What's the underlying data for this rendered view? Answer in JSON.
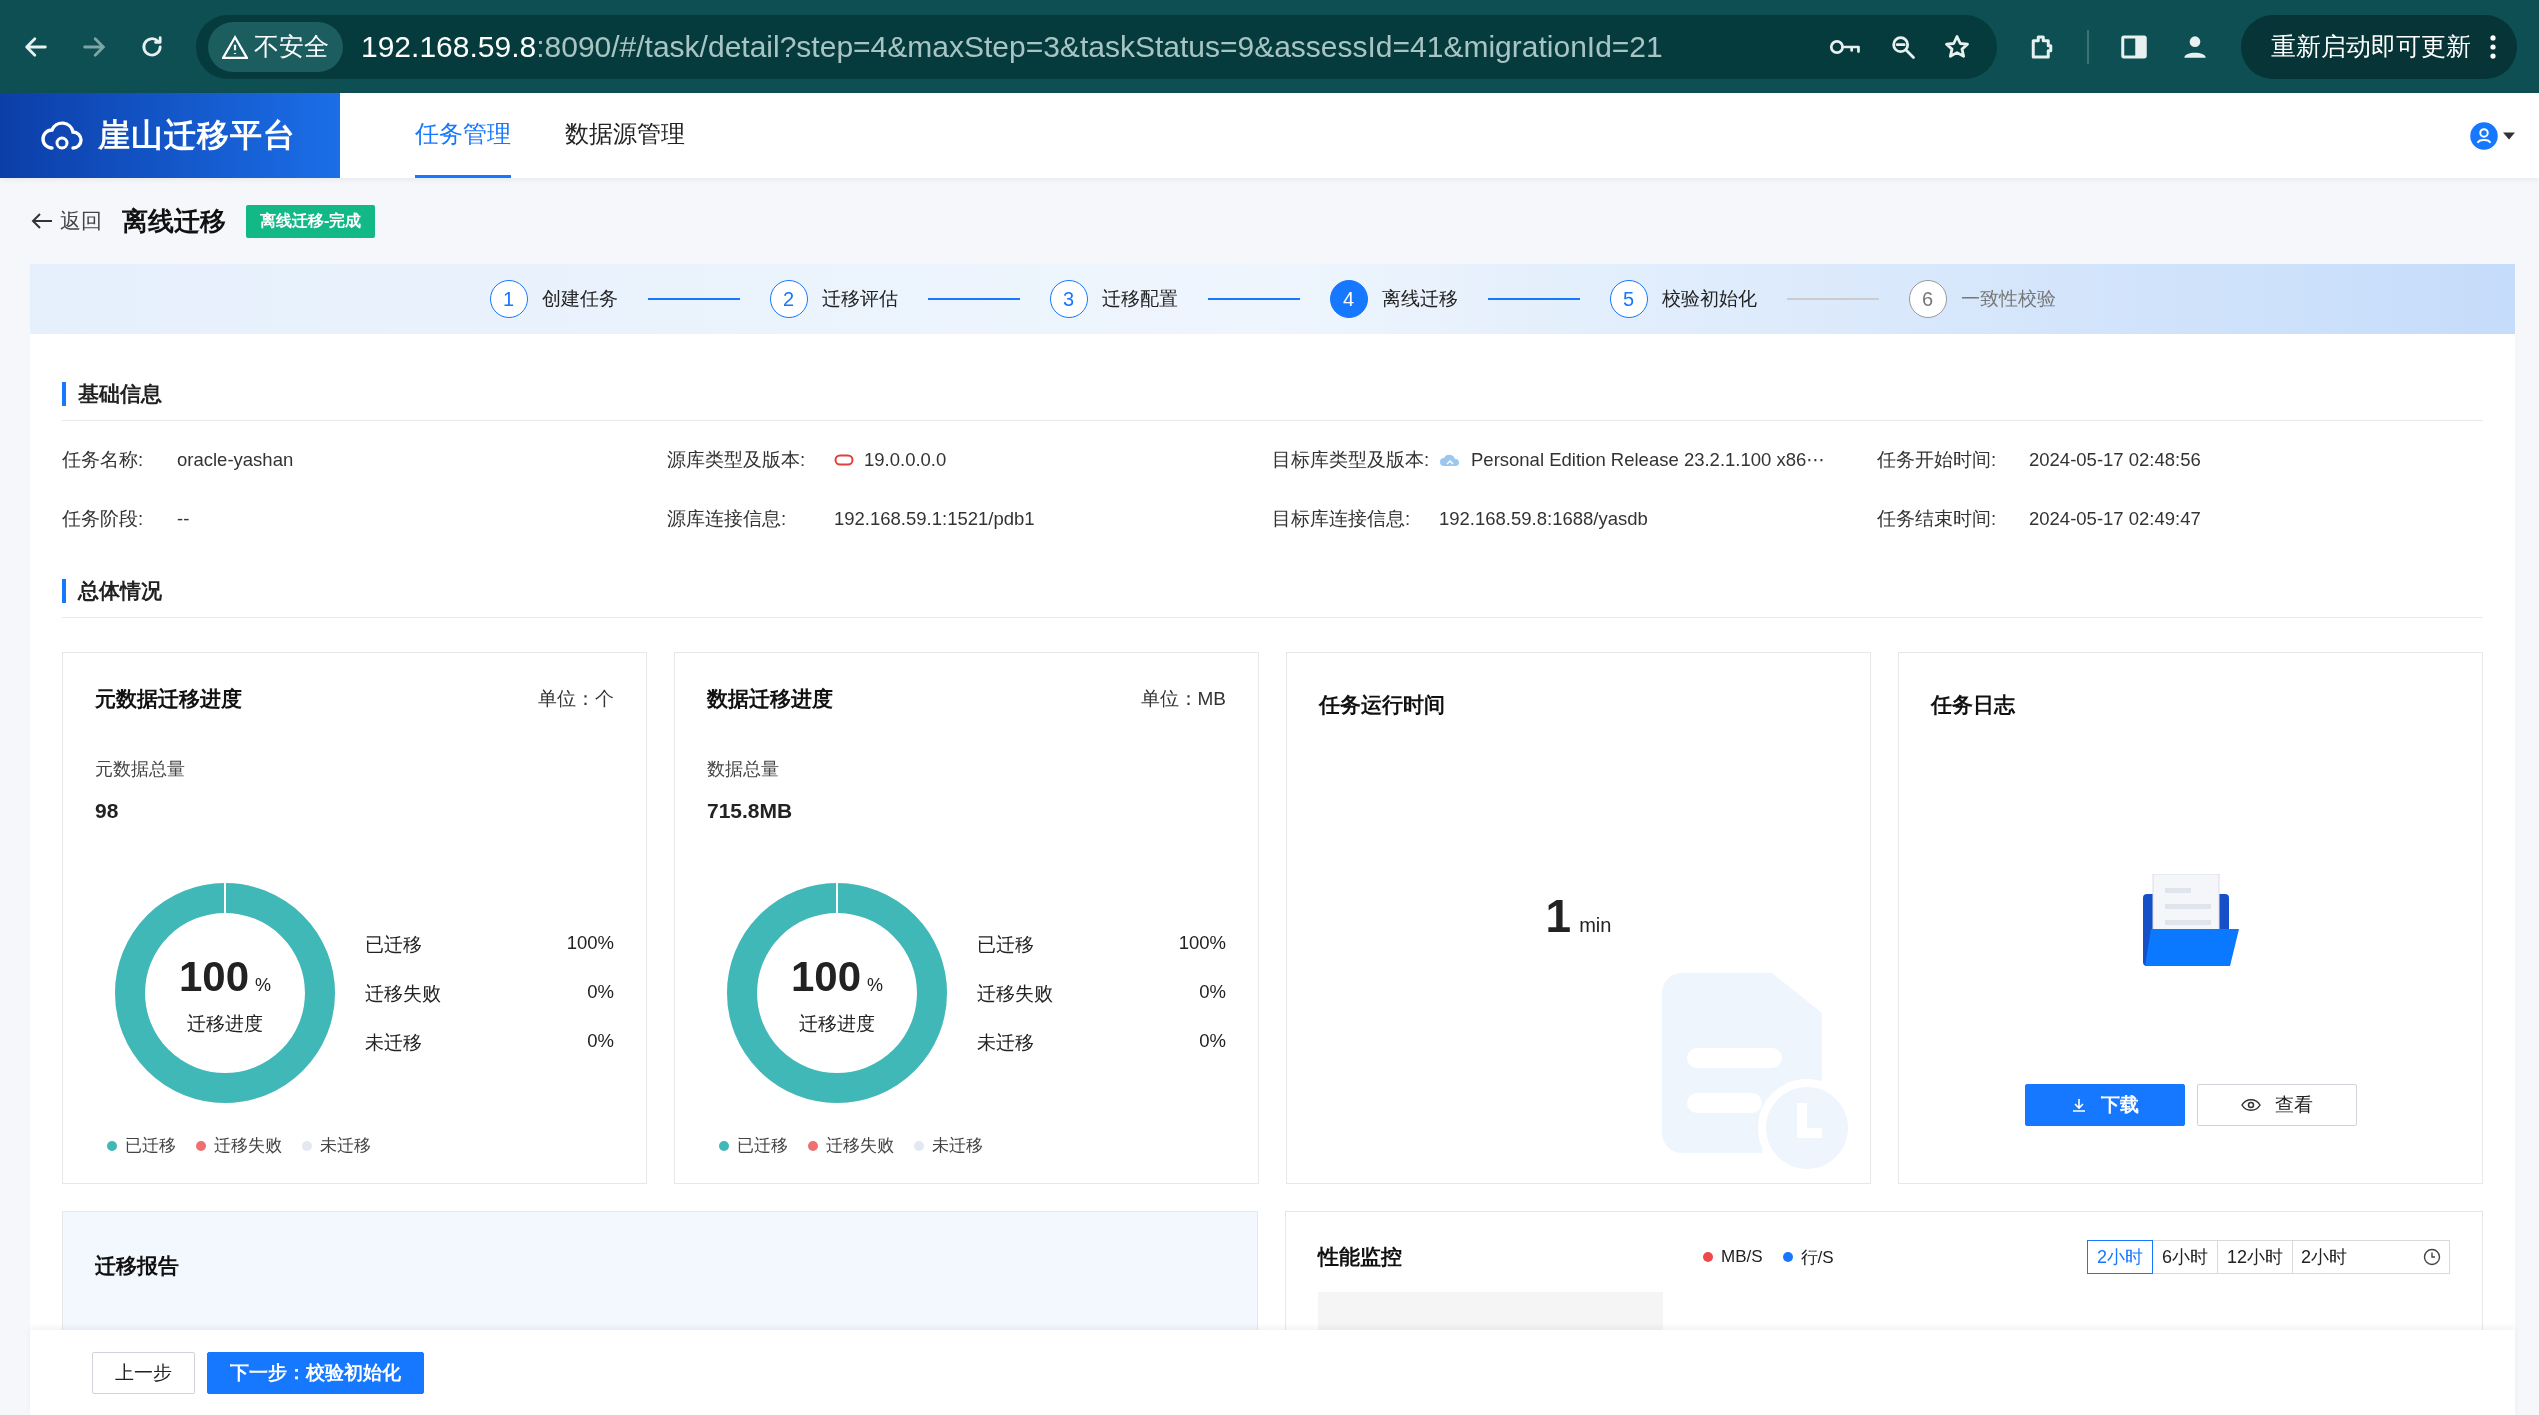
{
  "browser": {
    "security": "不安全",
    "url_host": "192.168.59.8",
    "url_rest": ":8090/#/task/detail?step=4&maxStep=3&taskStatus=9&assessId=41&migrationId=21",
    "update_button": "重新启动即可更新"
  },
  "app": {
    "logo": "崖山迁移平台",
    "nav": [
      {
        "label": "任务管理",
        "selected": true
      },
      {
        "label": "数据源管理",
        "selected": false
      }
    ]
  },
  "page": {
    "back": "返回",
    "title": "离线迁移",
    "status_tag": "离线迁移-完成"
  },
  "steps": [
    {
      "number": "1",
      "label": "创建任务",
      "selected": false,
      "disabled": false
    },
    {
      "number": "2",
      "label": "迁移评估",
      "selected": false,
      "disabled": false
    },
    {
      "number": "3",
      "label": "迁移配置",
      "selected": false,
      "disabled": false
    },
    {
      "number": "4",
      "label": "离线迁移",
      "selected": true,
      "disabled": false
    },
    {
      "number": "5",
      "label": "校验初始化",
      "selected": false,
      "disabled": false
    },
    {
      "number": "6",
      "label": "一致性校验",
      "selected": false,
      "disabled": true
    }
  ],
  "basic_info": {
    "title": "基础信息",
    "fields": [
      {
        "label": "任务名称:",
        "value": "oracle-yashan"
      },
      {
        "label": "源库类型及版本:",
        "value": "19.0.0.0.0",
        "kind": "oracle"
      },
      {
        "label": "目标库类型及版本:",
        "value": "Personal Edition Release 23.2.1.100 x86⋯",
        "kind": "cloud"
      },
      {
        "label": "任务开始时间:",
        "value": "2024-05-17 02:48:56"
      },
      {
        "label": "任务阶段:",
        "value": "--"
      },
      {
        "label": "源库连接信息:",
        "value": "192.168.59.1:1521/pdb1"
      },
      {
        "label": "目标库连接信息:",
        "value": "192.168.59.8:1688/yasdb"
      },
      {
        "label": "任务结束时间:",
        "value": "2024-05-17 02:49:47"
      }
    ]
  },
  "overview": {
    "title": "总体情况",
    "progress_cards": [
      {
        "title": "元数据迁移进度",
        "unit": "单位：个",
        "total_label": "元数据总量",
        "total_value": "98",
        "percent": "100",
        "percent_unit": "%",
        "center_label": "迁移进度",
        "level": 1,
        "stats": [
          {
            "label": "已迁移",
            "value": "100%"
          },
          {
            "label": "迁移失败",
            "value": "0%"
          },
          {
            "label": "未迁移",
            "value": "0%"
          }
        ],
        "legend": [
          {
            "label": "已迁移",
            "color": "#40b8b8"
          },
          {
            "label": "迁移失败",
            "color": "#ee7070"
          },
          {
            "label": "未迁移",
            "color": "#e4e8f0"
          }
        ]
      },
      {
        "title": "数据迁移进度",
        "unit": "单位：MB",
        "total_label": "数据总量",
        "total_value": "715.8MB",
        "percent": "100",
        "percent_unit": "%",
        "center_label": "迁移进度",
        "level": 1,
        "stats": [
          {
            "label": "已迁移",
            "value": "100%"
          },
          {
            "label": "迁移失败",
            "value": "0%"
          },
          {
            "label": "未迁移",
            "value": "0%"
          }
        ],
        "legend": [
          {
            "label": "已迁移",
            "color": "#40b8b8"
          },
          {
            "label": "迁移失败",
            "color": "#ee7070"
          },
          {
            "label": "未迁移",
            "color": "#e4e8f0"
          }
        ]
      }
    ],
    "runtime": {
      "title": "任务运行时间",
      "value": "1",
      "unit": "min"
    },
    "log": {
      "title": "任务日志",
      "buttons": [
        {
          "label": "下载",
          "kind": "primary"
        },
        {
          "label": "查看",
          "kind": "default"
        }
      ]
    }
  },
  "report": {
    "title": "迁移报告"
  },
  "monitor": {
    "title": "性能监控",
    "legend": [
      {
        "label": "MB/S",
        "color": "#f04848"
      },
      {
        "label": "行/S",
        "color": "#1677ff"
      }
    ],
    "ranges": [
      {
        "label": "2小时",
        "selected": true
      },
      {
        "label": "6小时",
        "selected": false
      },
      {
        "label": "12小时",
        "selected": false
      }
    ],
    "range_picker": "2小时"
  },
  "footer": {
    "buttons": [
      {
        "label": "上一步",
        "kind": "default"
      },
      {
        "label": "下一步：校验初始化",
        "kind": "primary"
      }
    ]
  }
}
